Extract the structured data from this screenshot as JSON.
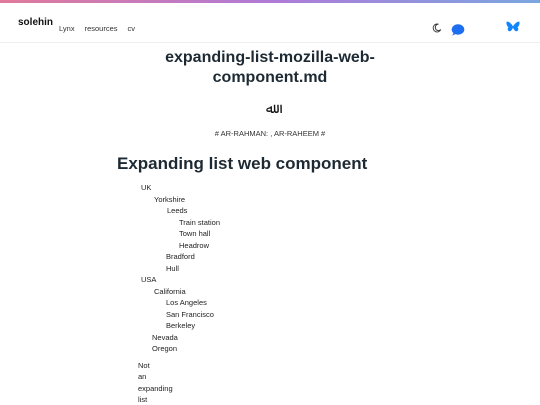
{
  "site": {
    "brand": "solehin",
    "nav": [
      "Lynx",
      "resources",
      "cv"
    ]
  },
  "icons": {
    "theme": "moon-icon",
    "chat": "chat-bubble-icon",
    "social": "butterfly-icon"
  },
  "colors": {
    "accent_gradient_start": "#e07a9b",
    "accent_gradient_end": "#7aa6e0",
    "chat_blue": "#1e6ff0",
    "bluesky_blue": "#1185fe",
    "heading": "#1e2a33"
  },
  "page": {
    "title_line1": "expanding-list-mozilla-web-",
    "title_line2": "component.md",
    "bismillah": "ﷲ",
    "subtitle": "# AR-RAHMAN: , AR-RAHEEM #",
    "heading": "Expanding list web component"
  },
  "tree": {
    "uk": "UK",
    "yorkshire": "Yorkshire",
    "leeds": "Leeds",
    "train_station": "Train station",
    "town_hall": "Town hall",
    "headrow": "Headrow",
    "bradford": "Bradford",
    "hull": "Hull",
    "usa": "USA",
    "california": "California",
    "los_angeles": "Los Angeles",
    "san_francisco": "San Francisco",
    "berkeley": "Berkeley",
    "nevada": "Nevada",
    "oregon": "Oregon"
  },
  "plain_list": [
    "Not",
    "an",
    "expanding",
    "list"
  ]
}
